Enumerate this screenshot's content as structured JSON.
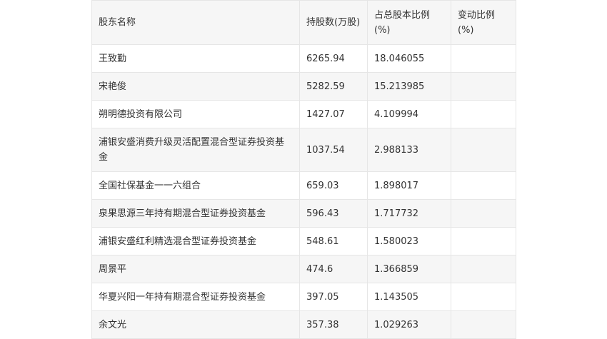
{
  "table": {
    "headers": [
      "股东名称",
      "持股数(万股)",
      "占总股本比例(%)",
      "变动比例(%)"
    ],
    "rows": [
      [
        "王致勤",
        "6265.94",
        "18.046055",
        ""
      ],
      [
        "宋艳俊",
        "5282.59",
        "15.213985",
        ""
      ],
      [
        "朔明德投资有限公司",
        "1427.07",
        "4.109994",
        ""
      ],
      [
        "浦银安盛消费升级灵活配置混合型证券投资基金",
        "1037.54",
        "2.988133",
        ""
      ],
      [
        "全国社保基金一一六组合",
        "659.03",
        "1.898017",
        ""
      ],
      [
        "泉果思源三年持有期混合型证券投资基金",
        "596.43",
        "1.717732",
        ""
      ],
      [
        "浦银安盛红利精选混合型证券投资基金",
        "548.61",
        "1.580023",
        ""
      ],
      [
        "周景平",
        "474.6",
        "1.366859",
        ""
      ],
      [
        "华夏兴阳一年持有期混合型证券投资基金",
        "397.05",
        "1.143505",
        ""
      ],
      [
        "余文光",
        "357.38",
        "1.029263",
        ""
      ]
    ]
  }
}
